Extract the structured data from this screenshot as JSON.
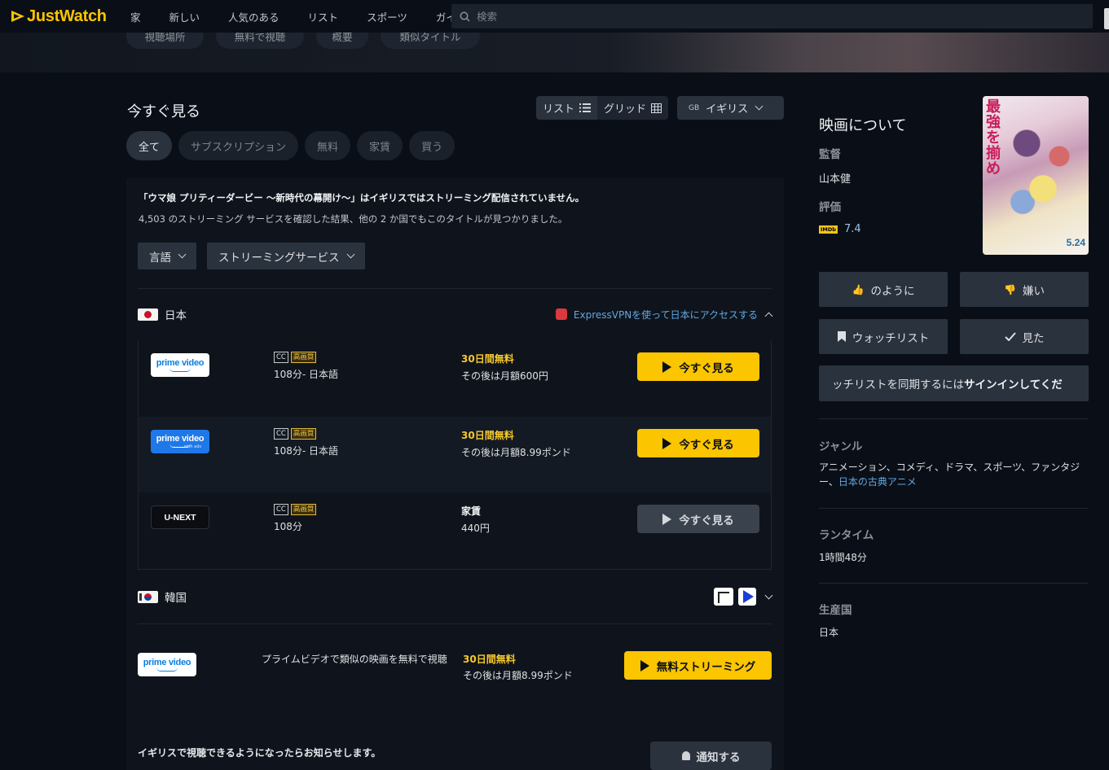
{
  "brand": {
    "name": "JustWatch",
    "color": "#fbc500"
  },
  "nav": [
    "家",
    "新しい",
    "人気のある",
    "リスト",
    "スポーツ",
    "ガイド"
  ],
  "search": {
    "placeholder": "検索",
    "icon": "search-icon"
  },
  "hero_chips": [
    "視聴場所",
    "無料で視聴",
    "概要",
    "類似タイトル"
  ],
  "where_to_watch": {
    "title": "今すぐ見る",
    "view_list": "リスト",
    "view_grid": "グリッド",
    "country_code": "GB",
    "country": "イギリス",
    "filters": [
      "全て",
      "サブスクリプション",
      "無料",
      "家賃",
      "買う"
    ],
    "active_filter": "全て"
  },
  "notice": {
    "title": "「ウマ娘 プリティーダービー 〜新時代の幕開け〜」はイギリスではストリーミング配信されていません。",
    "subtitle": "4,503 のストリーミング サービスを確認した結果、他の 2 か国でもこのタイトルが見つかりました。",
    "language_dropdown": "言語",
    "service_dropdown": "ストリーミングサービス"
  },
  "japan": {
    "name": "日本",
    "vpn_text": "ExpressVPNを使って日本にアクセスする",
    "offers": [
      {
        "provider": "prime video",
        "cc": "CC",
        "quality": "高画質",
        "meta": "108分- 日本語",
        "price_title": "30日間無料",
        "price_sub": "その後は月額600円",
        "cta": "今すぐ見る"
      },
      {
        "provider": "prime video",
        "ads_label": "with ads",
        "cc": "CC",
        "quality": "高画質",
        "meta": "108分- 日本語",
        "price_title": "30日間無料",
        "price_sub": "その後は月額8.99ポンド",
        "cta": "今すぐ見る"
      },
      {
        "provider": "U-NEXT",
        "cc": "CC",
        "quality": "高画質",
        "meta": "108分",
        "price_title": "家賃",
        "price_sub": "440円",
        "cta": "今すぐ見る"
      }
    ]
  },
  "korea": {
    "name": "韓国"
  },
  "similar": {
    "provider": "prime video",
    "text": "プライムビデオで類似の映画を無料で視聴",
    "price_title": "30日間無料",
    "price_sub": "その後は月額8.99ポンド",
    "cta": "無料ストリーミング"
  },
  "notify": {
    "text": "イギリスで視聴できるようになったらお知らせします。",
    "button": "通知する"
  },
  "about": {
    "title": "映画について",
    "director_label": "監督",
    "director": "山本健",
    "rating_label": "評価",
    "imdb_badge": "IMDb",
    "imdb_rating": "7.4",
    "poster_title": "最強を揃め",
    "poster_date": "5.24",
    "like": "のように",
    "dislike": "嫌い",
    "watchlist": "ウォッチリスト",
    "seen": "見た",
    "signin_prefix": "ッチリストを同期するには",
    "signin_bold": "サインインしてくだ",
    "genre_label": "ジャンル",
    "genres": "アニメーション、コメディ、ドラマ、スポーツ、ファンタジー、",
    "genre_link": "日本の古典アニメ",
    "runtime_label": "ランタイム",
    "runtime": "1時間48分",
    "country_label": "生産国",
    "country": "日本"
  }
}
